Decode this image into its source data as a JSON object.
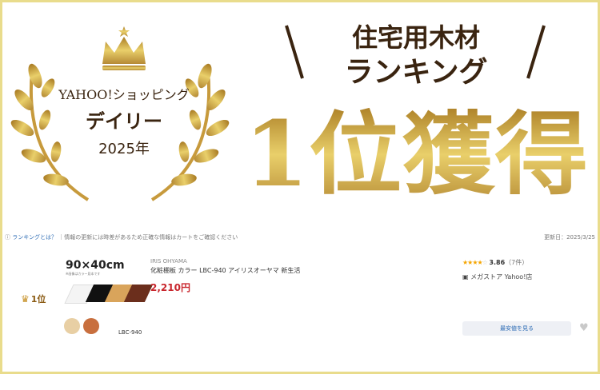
{
  "banner": {
    "left_line1": "YAHOO!ショッピング",
    "left_line2": "デイリー",
    "left_line3": "2025年",
    "right_line1": "住宅用木材",
    "right_line2": "ランキング",
    "big": "1位獲得"
  },
  "notice": {
    "link": "ランキングとは？",
    "text": "｜情報の更新には時差があるため正確な情報はカートをご確認ください",
    "updated": "更新日：2025/3/25"
  },
  "item": {
    "rank": "1位",
    "size": "90×40cm",
    "size_note": "※画像はカラー見本です",
    "model": "LBC-940",
    "brand": "IRIS OHYAMA",
    "title": "化粧棚板 カラー LBC-940 アイリスオーヤマ 新生活",
    "price": "2,210円",
    "stars": "★★★★",
    "half_star": "☆",
    "rating": "3.86",
    "reviews": "（7件）",
    "store": "メガストア Yahoo!店",
    "button": "最安値を見る"
  },
  "colors": {
    "gold": "#c79a3c",
    "brown": "#3a2410",
    "price": "#c8262d",
    "link": "#2f6db5",
    "border": "#e9dc8c"
  },
  "icons": [
    "crown-icon",
    "laurel-icon",
    "info-icon",
    "store-icon",
    "heart-icon"
  ]
}
